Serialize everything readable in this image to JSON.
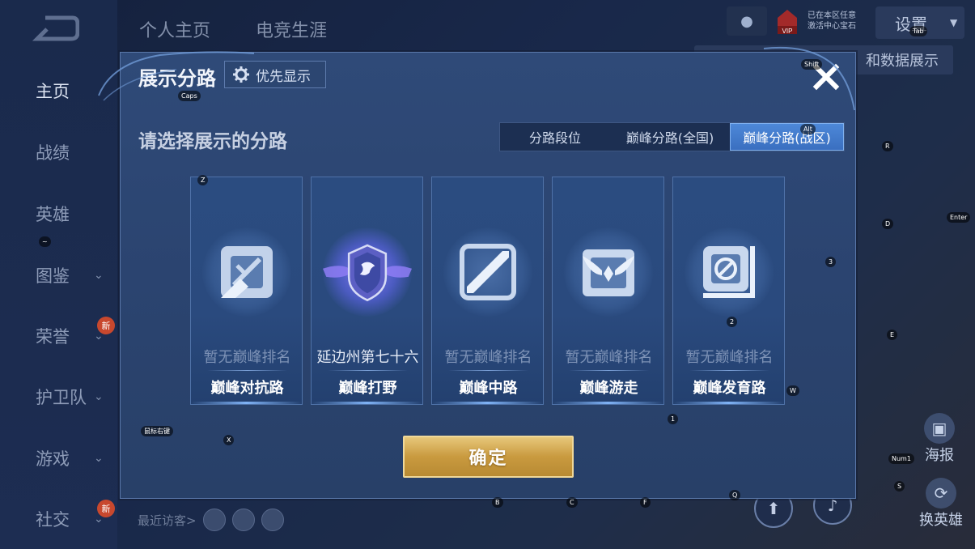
{
  "background": {
    "nav_tabs": [
      "个人主页",
      "电竞生涯"
    ],
    "sidebar_items": [
      {
        "label": "主页",
        "active": true,
        "chevron": false,
        "badge": ""
      },
      {
        "label": "战绩",
        "active": false,
        "chevron": false,
        "badge": ""
      },
      {
        "label": "英雄",
        "active": false,
        "chevron": false,
        "badge": ""
      },
      {
        "label": "图鉴",
        "active": false,
        "chevron": true,
        "badge": ""
      },
      {
        "label": "荣誉",
        "active": false,
        "chevron": true,
        "badge": "新"
      },
      {
        "label": "护卫队",
        "active": false,
        "chevron": true,
        "badge": ""
      },
      {
        "label": "游戏",
        "active": false,
        "chevron": true,
        "badge": ""
      },
      {
        "label": "社交",
        "active": false,
        "chevron": true,
        "badge": "新"
      }
    ],
    "vip_label": "VIP",
    "vip_line1": "已在本区任意",
    "vip_line2": "激活中心宝石",
    "settings_label": "设置",
    "banner_text": "和数据展示",
    "recent_visitors_label": "最近访客>",
    "poster_label": "海报",
    "switch_hero_label": "换英雄"
  },
  "modal": {
    "title": "展示分路",
    "priority_label": "优先显示",
    "subtitle": "请选择展示的分路",
    "tabs": [
      {
        "label": "分路段位",
        "active": false
      },
      {
        "label": "巅峰分路(全国)",
        "active": false
      },
      {
        "label": "巅峰分路(战区)",
        "active": true
      }
    ],
    "cards": [
      {
        "rank_text": "暂无巅峰排名",
        "lane_name": "巅峰对抗路",
        "icon": "clash-lane-icon",
        "has_rank": false
      },
      {
        "rank_text": "延边州第七十六",
        "lane_name": "巅峰打野",
        "icon": "jungle-crest-icon",
        "has_rank": true
      },
      {
        "rank_text": "暂无巅峰排名",
        "lane_name": "巅峰中路",
        "icon": "mid-lane-icon",
        "has_rank": false
      },
      {
        "rank_text": "暂无巅峰排名",
        "lane_name": "巅峰游走",
        "icon": "roam-wings-icon",
        "has_rank": false
      },
      {
        "rank_text": "暂无巅峰排名",
        "lane_name": "巅峰发育路",
        "icon": "farm-lane-icon",
        "has_rank": false
      }
    ],
    "confirm_label": "确定"
  },
  "key_hints": {
    "caps": "Caps",
    "shift": "Shift",
    "tab": "Tab",
    "alt": "Alt",
    "r": "R",
    "z": "Z",
    "d": "D",
    "enter": "Enter",
    "tilde": "~",
    "three": "3",
    "two": "2",
    "e": "E",
    "w": "W",
    "one": "1",
    "x": "X",
    "mouse": "鼠标右键",
    "num1": "Num1",
    "s": "S",
    "b": "B",
    "c": "C",
    "f": "F",
    "q": "Q"
  },
  "colors": {
    "accent_tab": "#3a6fc0",
    "confirm_gold": "#c99a3f",
    "modal_bg": "#2b4470"
  }
}
